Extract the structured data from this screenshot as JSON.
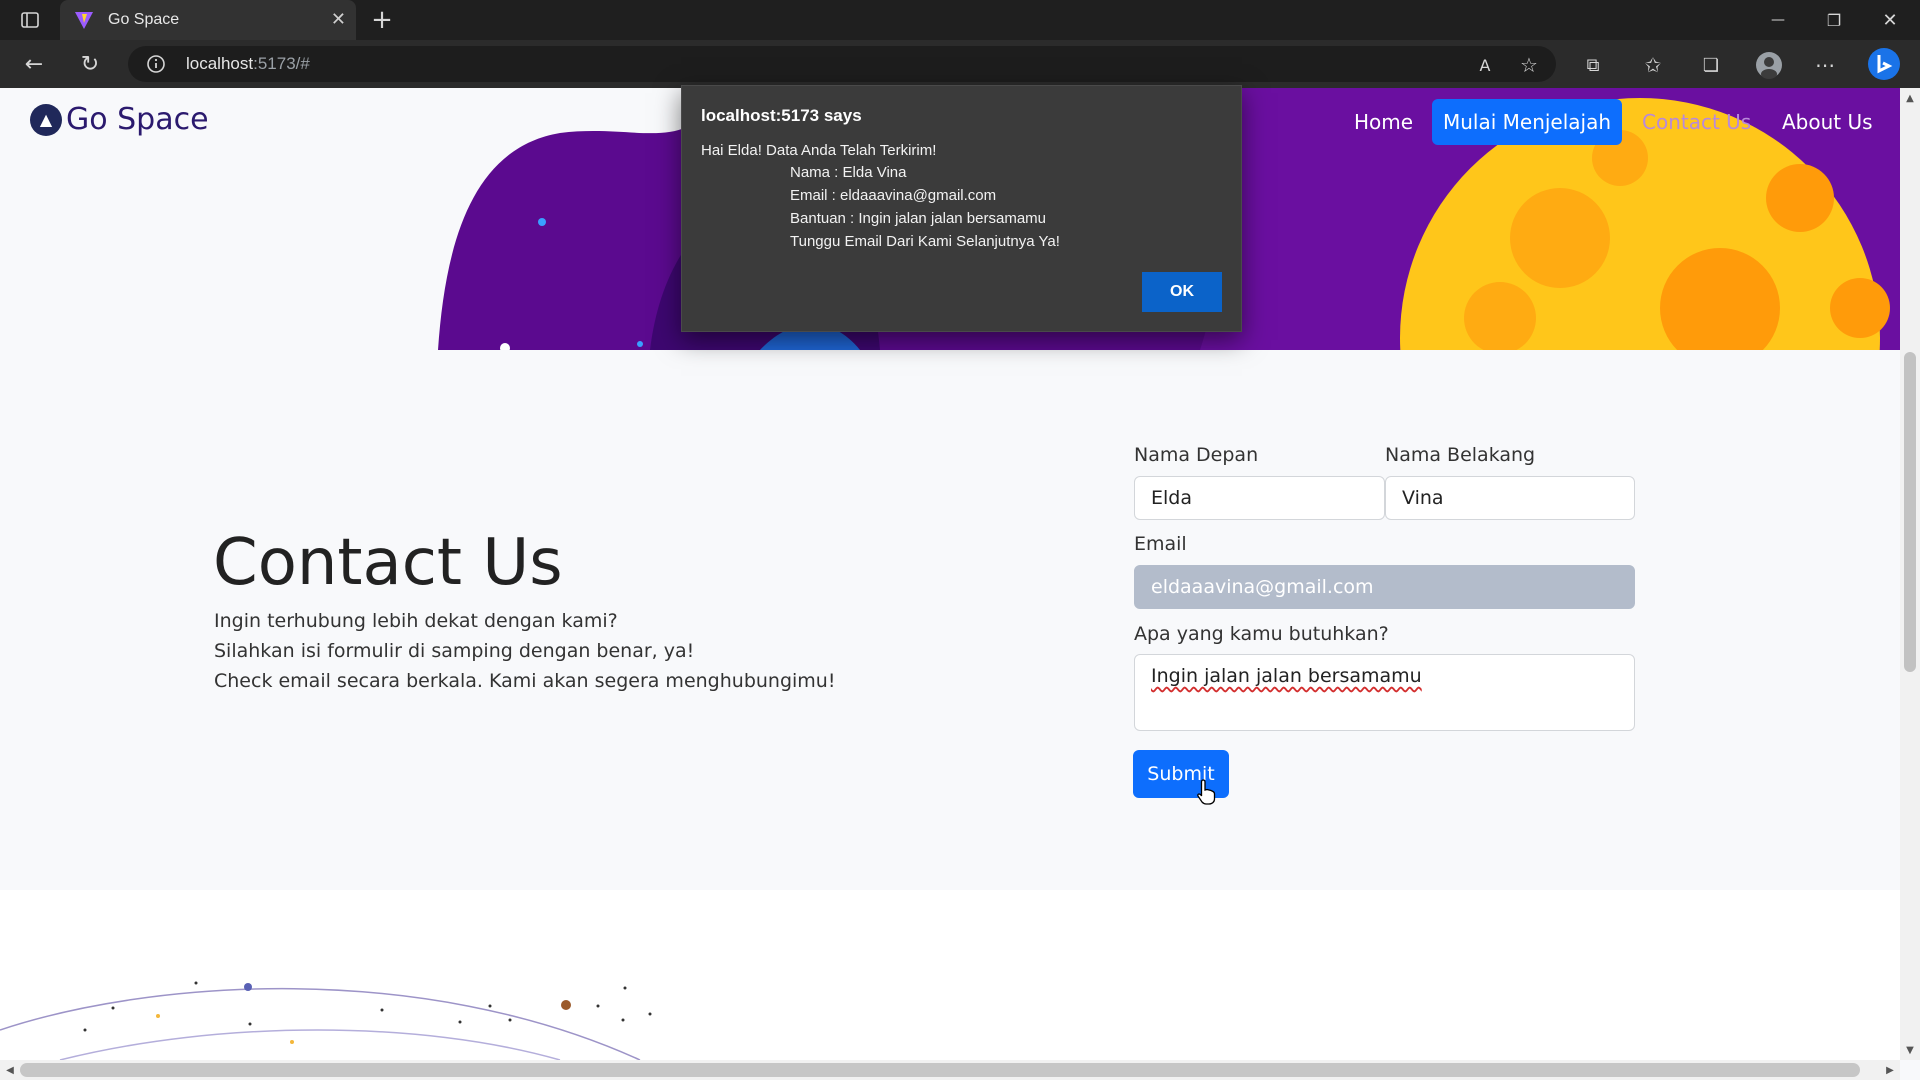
{
  "browser": {
    "tab_title": "Go Space",
    "url_host": "localhost",
    "url_rest": ":5173/#",
    "tab_close": "✕",
    "new_tab": "+",
    "controls": {
      "minimize": "—",
      "maximize": "❐",
      "close": "✕"
    }
  },
  "header": {
    "logo_text": "Go Space",
    "nav": {
      "home": "Home",
      "cta": "Mulai Menjelajah",
      "contact": "Contact Us",
      "about": "About Us"
    }
  },
  "contact": {
    "title": "Contact Us",
    "lines": [
      "Ingin terhubung lebih dekat dengan kami?",
      "Silahkan isi formulir di samping dengan benar, ya!",
      "Check email secara berkala. Kami akan segera menghubungimu!"
    ]
  },
  "form": {
    "first_name_label": "Nama Depan",
    "first_name_value": "Elda",
    "last_name_label": "Nama Belakang",
    "last_name_value": "Vina",
    "email_label": "Email",
    "email_value": "eldaaavina@gmail.com",
    "need_label": "Apa yang kamu butuhkan?",
    "need_value": "Ingin jalan jalan bersamamu",
    "submit_label": "Submit"
  },
  "dialog": {
    "title": "localhost:5173 says",
    "lines": [
      "Hai Elda! Data Anda Telah Terkirim!",
      "Nama : Elda Vina",
      "Email : eldaaavina@gmail.com",
      "Bantuan : Ingin jalan jalan bersamamu",
      "Tunggu Email Dari Kami Selanjutnya Ya!"
    ],
    "ok_label": "OK"
  },
  "colors": {
    "primary": "#0d6efd",
    "purple": "#5a0a8c",
    "planet": "#ffc61a"
  }
}
